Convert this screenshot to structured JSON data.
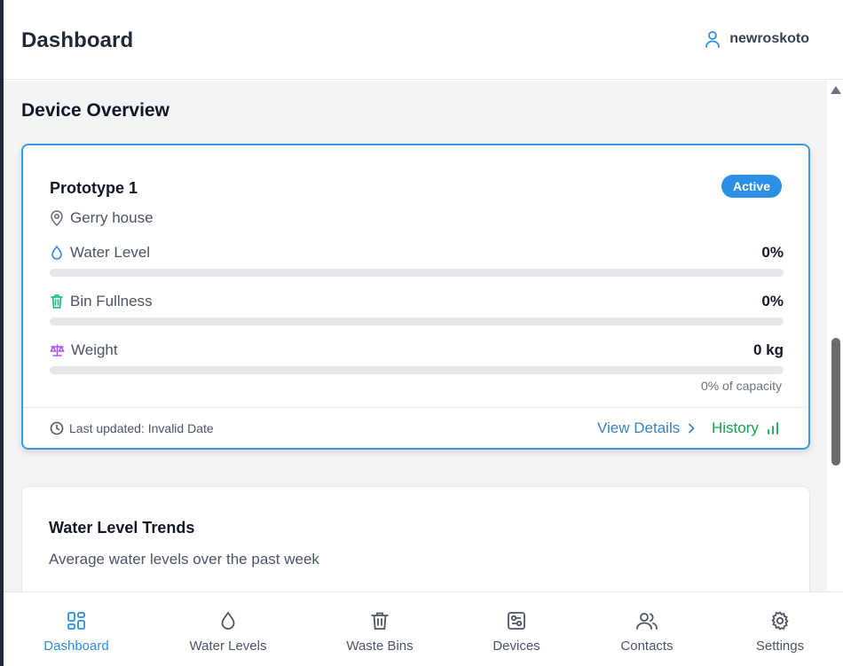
{
  "header": {
    "title": "Dashboard",
    "username": "newroskoto",
    "user_icon": "user-icon"
  },
  "main": {
    "section_title": "Device Overview",
    "device": {
      "name": "Prototype 1",
      "status": "Active",
      "location": "Gerry house",
      "metrics": [
        {
          "label": "Water Level",
          "value": "0%",
          "level": 0,
          "icon": "water-drop-icon",
          "color": "#3b82f6"
        },
        {
          "label": "Bin Fullness",
          "value": "0%",
          "level": 0,
          "icon": "trash-icon",
          "color": "#10b981"
        },
        {
          "label": "Weight",
          "value": "0 kg",
          "level": 0,
          "icon": "scale-icon",
          "color": "#a855f7"
        }
      ],
      "capacity_note": "0% of capacity",
      "last_updated": "Last updated: Invalid Date",
      "view_details": "View Details",
      "history": "History"
    },
    "trend_card": {
      "title": "Water Level Trends",
      "subtitle": "Average water levels over the past week"
    }
  },
  "bottom_nav": [
    {
      "label": "Dashboard",
      "icon": "dashboard-icon",
      "active": true
    },
    {
      "label": "Water Levels",
      "icon": "water-drop-icon",
      "active": false
    },
    {
      "label": "Waste Bins",
      "icon": "trash-icon",
      "active": false
    },
    {
      "label": "Devices",
      "icon": "devices-icon",
      "active": false
    },
    {
      "label": "Contacts",
      "icon": "contacts-icon",
      "active": false
    },
    {
      "label": "Settings",
      "icon": "gear-icon",
      "active": false
    }
  ],
  "colors": {
    "accent": "#2b8fe6",
    "history_green": "#16a34a",
    "link_blue": "#3b82c4"
  }
}
